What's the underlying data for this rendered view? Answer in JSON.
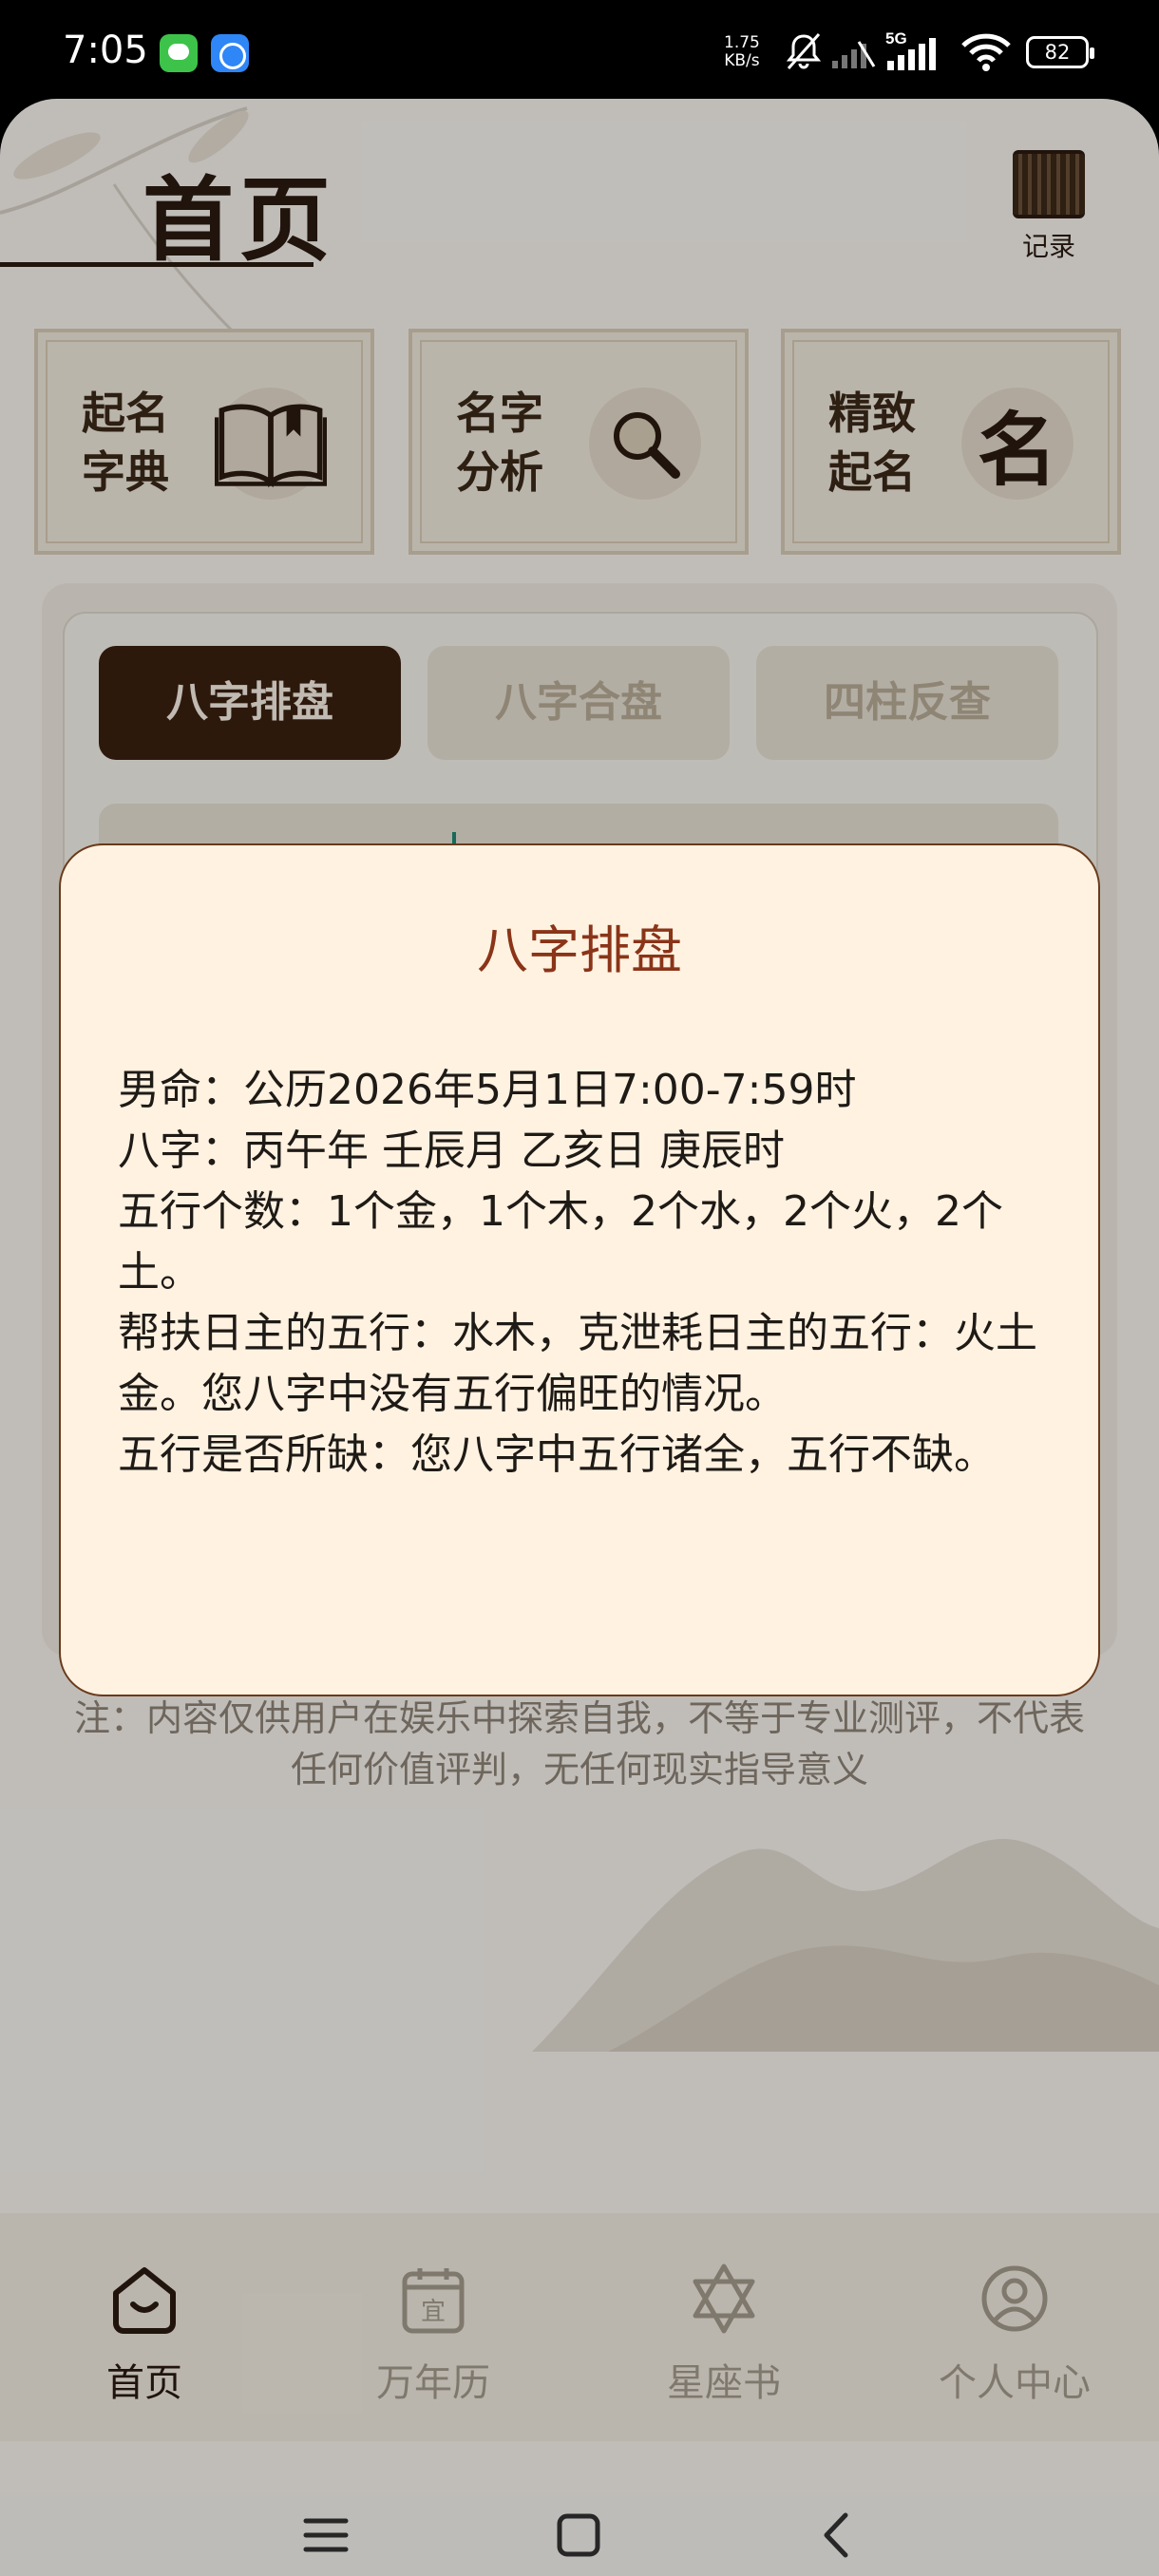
{
  "status_bar": {
    "time": "7:05",
    "net_speed_value": "1.75",
    "net_speed_unit": "KB/s",
    "network_type": "5G",
    "battery": "82",
    "icons": [
      "message-icon",
      "browser-icon",
      "mute-icon",
      "signal-icon",
      "wifi-icon",
      "battery-icon"
    ]
  },
  "header": {
    "title": "首页",
    "record_label": "记录"
  },
  "features": [
    {
      "label": "起名字典",
      "icon": "book-icon"
    },
    {
      "label": "名字分析",
      "icon": "search-icon"
    },
    {
      "label": "精致起名",
      "icon": "name-glyph",
      "glyph": "名"
    }
  ],
  "tabs": [
    {
      "label": "八字排盘",
      "active": true
    },
    {
      "label": "八字合盘",
      "active": false
    },
    {
      "label": "四柱反查",
      "active": false
    }
  ],
  "disclaimer": "注：内容仅供用户在娱乐中探索自我，不等于专业测评，不代表任何价值评判，无任何现实指导意义",
  "dialog": {
    "title": "八字排盘",
    "lines": [
      "男命：公历2026年5月1日7:00-7:59时",
      "八字：丙午年 壬辰月 乙亥日 庚辰时",
      "五行个数：1个金，1个木，2个水，2个火，2个土。",
      "帮扶日主的五行：水木，克泄耗日主的五行：火土金。您八字中没有五行偏旺的情况。",
      "五行是否所缺：您八字中五行诸全，五行不缺。"
    ]
  },
  "bottom_nav": [
    {
      "label": "首页",
      "icon": "home-icon",
      "active": true
    },
    {
      "label": "万年历",
      "icon": "calendar-icon",
      "active": false,
      "icon_text": "宜"
    },
    {
      "label": "星座书",
      "icon": "star-of-david-icon",
      "active": false
    },
    {
      "label": "个人中心",
      "icon": "profile-icon",
      "active": false
    }
  ],
  "colors": {
    "accent_dark": "#3a2010",
    "dialog_bg": "#fff2e1",
    "dialog_title": "#8a3418",
    "page_bg": "#f6f3ee"
  }
}
